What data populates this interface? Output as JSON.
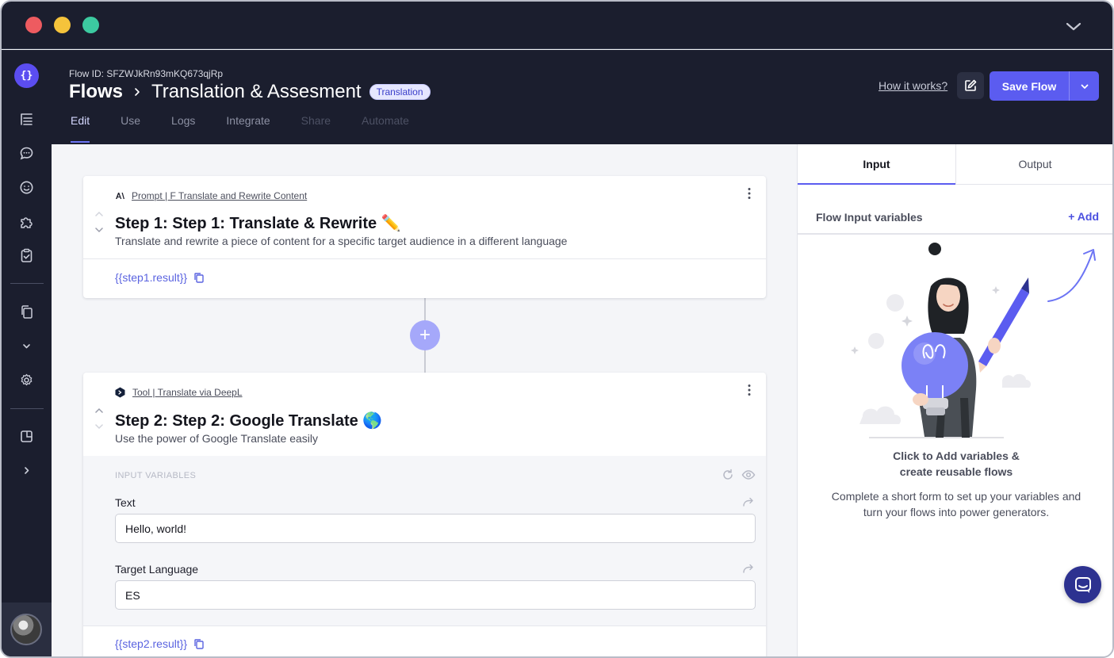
{
  "window": {
    "title_bar_controls": [
      "close",
      "minimize",
      "maximize"
    ]
  },
  "sidebar": {
    "logo": "{}",
    "icons": [
      "list-tree-icon",
      "chat-icon",
      "smile-icon",
      "puzzle-icon",
      "clipboard-check-icon",
      "files-icon",
      "chevron-down-icon",
      "settings-icon",
      "panel-icon",
      "chevron-right-icon"
    ]
  },
  "header": {
    "flow_id": "Flow ID: SFZWJkRn93mKQ673qjRp",
    "crumb_root": "Flows",
    "crumb_page": "Translation & Assesment",
    "badge": "Translation",
    "tabs": [
      {
        "label": "Edit",
        "state": "active"
      },
      {
        "label": "Use",
        "state": "normal"
      },
      {
        "label": "Logs",
        "state": "normal"
      },
      {
        "label": "Integrate",
        "state": "normal"
      },
      {
        "label": "Share",
        "state": "disabled"
      },
      {
        "label": "Automate",
        "state": "disabled"
      }
    ],
    "how_it_works": "How it works?",
    "save_label": "Save Flow"
  },
  "steps": [
    {
      "tag": "Prompt | F Translate and Rewrite Content",
      "title": "Step 1: Step 1: Translate & Rewrite ✏️",
      "description": "Translate and rewrite a piece of content for a specific target audience in a different language",
      "result": "{{step1.result}}"
    },
    {
      "tag": "Tool | Translate via DeepL",
      "title": "Step 2: Step 2: Google Translate 🌎",
      "description": "Use the power of Google Translate easily",
      "input_variables_label": "INPUT VARIABLES",
      "fields": [
        {
          "label": "Text",
          "value": "Hello, world!"
        },
        {
          "label": "Target Language",
          "value": "ES"
        }
      ],
      "result": "{{step2.result}}"
    }
  ],
  "add_step": "+",
  "right_panel": {
    "tabs": [
      {
        "label": "Input",
        "state": "active"
      },
      {
        "label": "Output",
        "state": "normal"
      }
    ],
    "variables_label": "Flow Input variables",
    "add_label": "+ Add",
    "empty_title": "Click to Add variables & create reusable flows",
    "empty_desc": "Complete a short form to set up your variables and turn your flows into power generators."
  },
  "colors": {
    "accent": "#5b5cf0",
    "dark_bg": "#1b1e2e",
    "link": "#5a63e0",
    "badge_bg": "#e5e6ff"
  }
}
